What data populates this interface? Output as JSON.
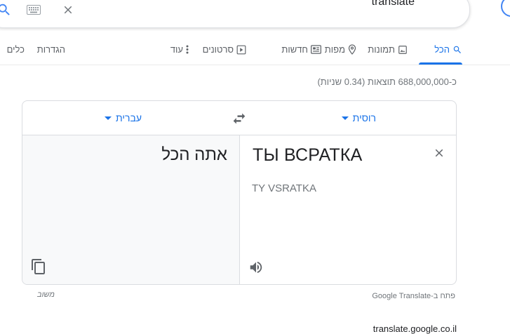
{
  "search": {
    "query": "translate"
  },
  "tabs": [
    {
      "label": "הכל",
      "icon": "search-icon",
      "active": true
    },
    {
      "label": "תמונות",
      "icon": "image-icon"
    },
    {
      "label": "מפות",
      "icon": "map-pin-icon"
    },
    {
      "label": "חדשות",
      "icon": "news-icon"
    },
    {
      "label": "סרטונים",
      "icon": "video-icon"
    },
    {
      "label": "עוד",
      "icon": "more-vert-icon"
    }
  ],
  "tools": {
    "settings": "הגדרות",
    "tools_cut": "כלים"
  },
  "stats": "כ-688,000,000 תוצאות (0.34 שניות)",
  "translate": {
    "source_lang": "עברית",
    "target_lang": "רוסית",
    "source_text": "אתה הכל",
    "translated_text": "ТЫ ВСРАТКА",
    "transliteration": "TY VSRATKA"
  },
  "footer": {
    "feedback": "משוב",
    "open_in": "פתח ב-Google Translate"
  },
  "result": {
    "url": "translate.google.co.il"
  },
  "colors": {
    "accent": "#1a73e8",
    "border": "#dadce0",
    "muted": "#70757a"
  }
}
